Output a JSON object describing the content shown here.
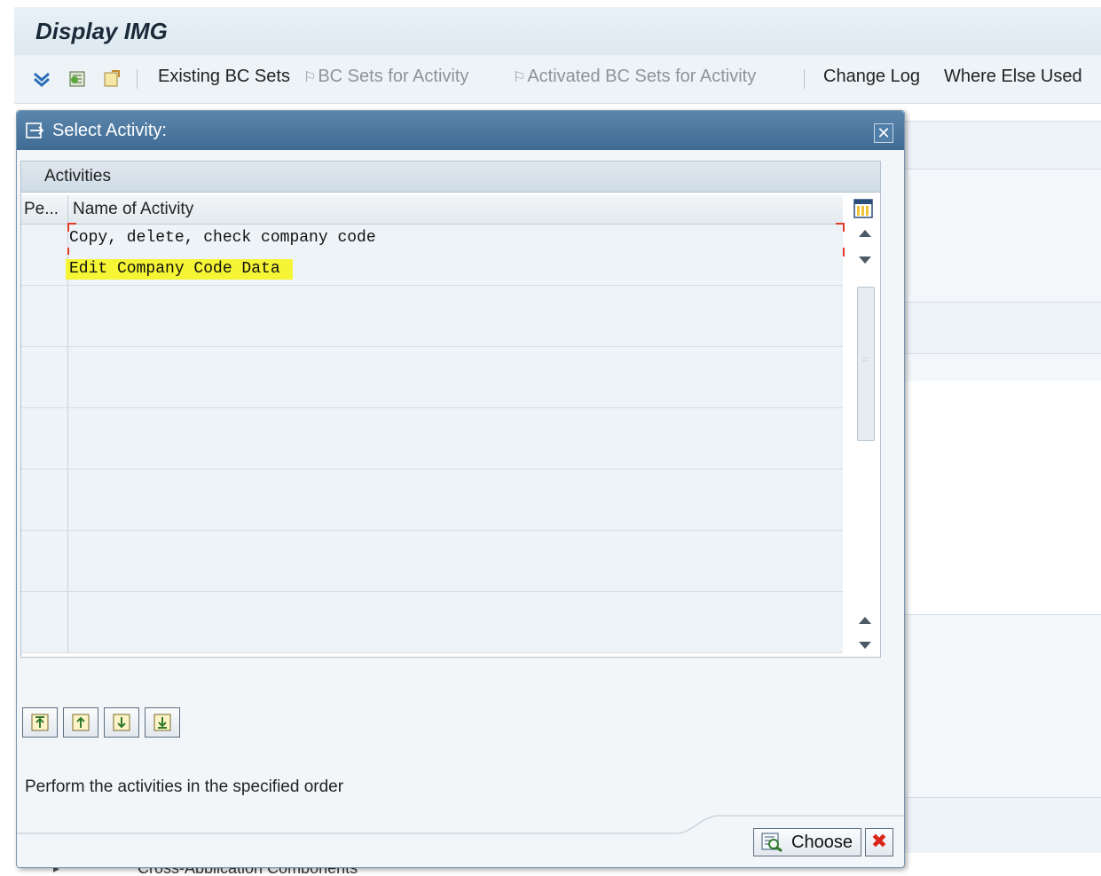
{
  "app": {
    "title": "Display IMG",
    "toolbar": {
      "existing_bc_sets": "Existing BC Sets",
      "bc_sets_for_activity": "BC Sets for Activity",
      "activated_bc_sets_for_activity": "Activated BC Sets for Activity",
      "change_log": "Change Log",
      "where_else_used": "Where Else Used"
    },
    "tree_item_partial": "Cross-Application Components"
  },
  "dialog": {
    "title": "Select Activity:",
    "grid": {
      "caption": "Activities",
      "columns": [
        "Pe...",
        "Name of Activity"
      ],
      "rows": [
        {
          "perform": "",
          "name": "Copy, delete, check company code"
        },
        {
          "perform": "",
          "name": "Edit Company Code Data"
        }
      ]
    },
    "info_text": "Perform the activities in the specified order",
    "choose_label": "Choose",
    "cancel_glyph": "✖"
  },
  "colors": {
    "dialog_header": "#3f6b94",
    "highlight": "#f5f535",
    "focus_marker": "#e53a2a",
    "cancel": "#d9261b"
  },
  "icons": {
    "toolbar": [
      "expand-tree-icon",
      "bookmark-icon",
      "note-icon"
    ],
    "dialog": [
      "dialog-icon",
      "close-icon",
      "column-layout-icon",
      "choose-icon",
      "cancel-icon"
    ],
    "order_buttons": [
      "top-icon",
      "up-icon",
      "down-icon",
      "bottom-icon"
    ]
  }
}
